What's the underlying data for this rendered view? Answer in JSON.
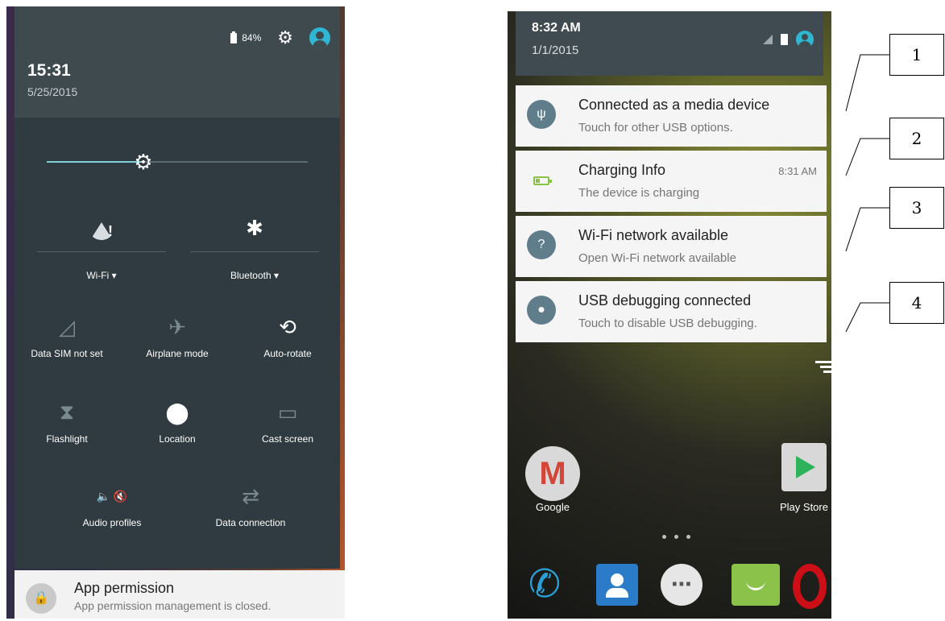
{
  "left_screen": {
    "status": {
      "battery": "84%"
    },
    "time": "15:31",
    "date": "5/25/2015",
    "brightness": {
      "level": 0.37
    },
    "toggles": [
      {
        "label": "Wi-Fi",
        "icon": "wifi-warning-icon",
        "expandable": true
      },
      {
        "label": "Bluetooth",
        "icon": "bluetooth-icon",
        "expandable": true
      }
    ],
    "tiles": [
      {
        "label": "Data SIM not set",
        "icon": "signal-off-icon"
      },
      {
        "label": "Airplane mode",
        "icon": "airplane-icon"
      },
      {
        "label": "Auto-rotate",
        "icon": "auto-rotate-icon"
      },
      {
        "label": "Flashlight",
        "icon": "flashlight-icon"
      },
      {
        "label": "Location",
        "icon": "location-pin-icon"
      },
      {
        "label": "Cast screen",
        "icon": "cast-icon"
      },
      {
        "label": "Audio profiles",
        "icon": "audio-profiles-icon"
      },
      {
        "label": "Data connection",
        "icon": "data-connection-icon"
      }
    ],
    "notification": {
      "title": "App permission",
      "text": "App permission management is closed."
    }
  },
  "right_screen": {
    "time": "8:32 AM",
    "date": "1/1/2015",
    "notifications": [
      {
        "title": "Connected as a media device",
        "text": "Touch for other USB options.",
        "icon": "usb-icon",
        "time": ""
      },
      {
        "title": "Charging Info",
        "text": "The device is charging",
        "icon": "battery-charging-icon",
        "time": "8:31 AM"
      },
      {
        "title": "Wi-Fi network available",
        "text": "Open Wi-Fi network available",
        "icon": "wifi-question-icon",
        "time": ""
      },
      {
        "title": "USB debugging connected",
        "text": "Touch to disable USB debugging.",
        "icon": "android-debug-icon",
        "time": ""
      }
    ],
    "home_icons": [
      {
        "label": "Google",
        "icon": "gmail-icon"
      },
      {
        "label": "Play Store",
        "icon": "play-store-icon"
      }
    ],
    "dock": [
      {
        "icon": "phone-icon"
      },
      {
        "icon": "contacts-icon"
      },
      {
        "icon": "app-drawer-icon"
      },
      {
        "icon": "messaging-icon"
      },
      {
        "icon": "opera-icon"
      }
    ]
  },
  "callouts": [
    "1",
    "2",
    "3",
    "4"
  ]
}
